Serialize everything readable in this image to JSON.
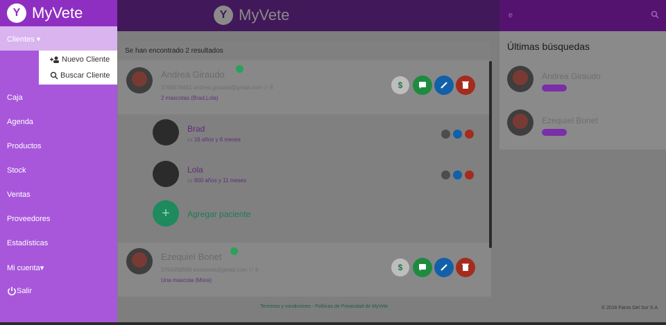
{
  "sidebar": {
    "brand": "MyVete",
    "clientes": "Clientes",
    "dropdown": [
      "Nuevo Cliente",
      "Buscar Cliente"
    ],
    "items": [
      "Caja",
      "Agenda",
      "Productos",
      "Stock",
      "Ventas",
      "Proveedores",
      "Estadísticas",
      "Mi cuenta"
    ],
    "logout": "Salir"
  },
  "header": {
    "brand": "MyVete",
    "search_value": "e"
  },
  "results": {
    "summary": "Se han encontrado 2 resultados",
    "clients": [
      {
        "name": "Andrea Giraudo",
        "meta": "3764678451   andrea.giraudo@gmail.com   ⚇ 8",
        "pets_label": "2 mascotas (Brad,Lola)",
        "money": "$"
      },
      {
        "name": "Ezequiel Bonet",
        "meta": "3764458569   ezebonet@gmail.com   ⚇ 6",
        "pets_label": "Una mascota (Mora)",
        "money": "$"
      }
    ],
    "pets": [
      {
        "name": "Brad",
        "age": "16 años y 6 meses"
      },
      {
        "name": "Lola",
        "age": "900 años y 11 meses"
      }
    ],
    "add_patient": "Agregar paciente",
    "add_symbol": "+"
  },
  "recent": {
    "title": "Últimas búsquedas",
    "items": [
      {
        "name": "Andrea Giraudo"
      },
      {
        "name": "Ezequiel Bonet"
      }
    ]
  },
  "footer": {
    "links": "Terminos y condiciones - Politicas de Privacidad de MyVete",
    "copy": "© 2016 Faros Del Sur S.A."
  },
  "colors": {
    "sidebar": "#a857db",
    "topbar": "#411859",
    "accent_green": "#1e8b3f",
    "accent_blue": "#1260a8",
    "accent_red": "#a42c1f"
  },
  "icons": [
    "logo-icon",
    "search-icon",
    "add-user-icon",
    "search-user-icon",
    "power-icon",
    "money-icon",
    "message-icon",
    "edit-icon",
    "delete-icon",
    "calendar-icon",
    "folder-icon"
  ]
}
